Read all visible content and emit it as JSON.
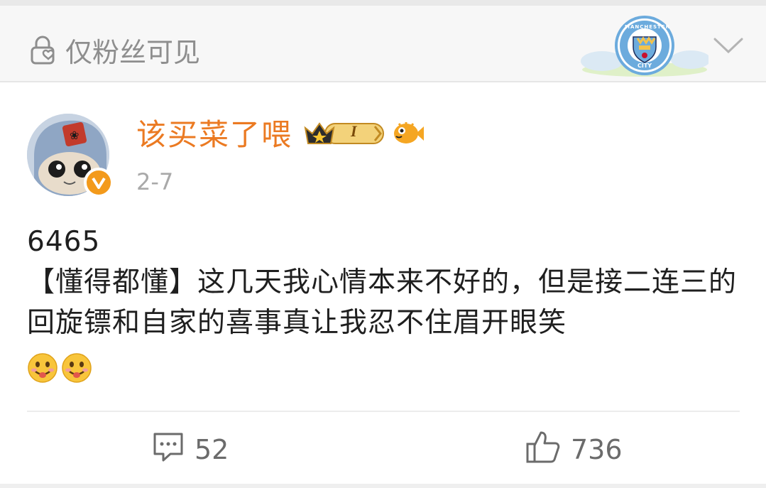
{
  "header": {
    "visibility_label": "仅粉丝可见",
    "visibility_icon": "lock-heart-icon",
    "badge_icon": "manchester-city-crest-icon",
    "badge_text_top": "MANCHESTER",
    "badge_text_bottom": "CITY",
    "expand_icon": "chevron-down-icon"
  },
  "post": {
    "username": "该买菜了喂",
    "vip_level": "I",
    "date": "2-7",
    "verified_icon": "verified-v-icon",
    "content_lines": [
      "6465",
      "【懂得都懂】这几天我心情本来不好的，但是接二连三的回旋镖和自家的喜事真让我忍不住眉开眼笑"
    ],
    "emojis": [
      "drooling-emoji",
      "drooling-emoji"
    ]
  },
  "actions": {
    "comment_count": "52",
    "like_count": "736"
  },
  "colors": {
    "username": "#eb7a22",
    "verified": "#f39a1b",
    "muted": "#8e8e8e"
  }
}
